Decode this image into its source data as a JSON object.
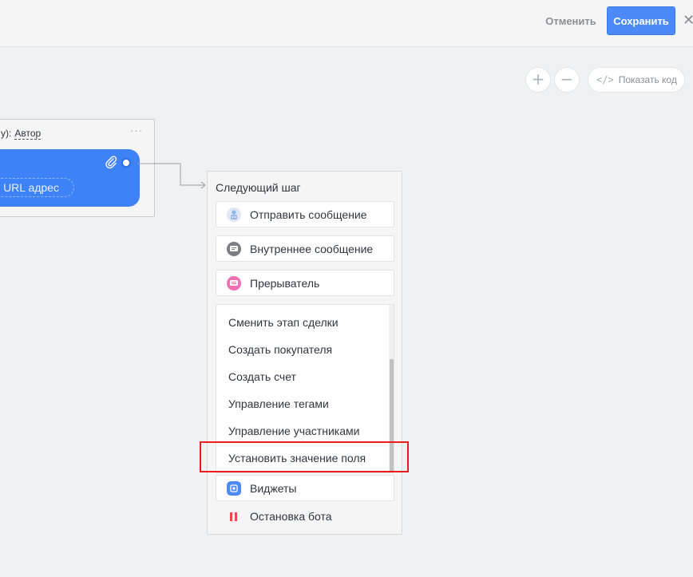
{
  "header": {
    "cancel_label": "Отменить",
    "save_label": "Сохранить",
    "close_icon": "close-icon"
  },
  "toolbar": {
    "zoom_in_icon": "plus",
    "zoom_out_icon": "minus",
    "show_code_label": "Показать код",
    "code_icon_glyph": "</>"
  },
  "node": {
    "header_prefix": "у):",
    "author_label": "Автор",
    "menu_glyph": "···",
    "url_chip_label": "+ URL адрес"
  },
  "next_step": {
    "title": "Следующий шаг",
    "actions": [
      {
        "label": "Отправить сообщение",
        "icon": "bot-icon",
        "color": "#8ab4f8"
      },
      {
        "label": "Внутреннее сообщение",
        "icon": "chat-icon",
        "color": "#7b7f85"
      },
      {
        "label": "Прерыватель",
        "icon": "interrupt-icon",
        "color": "#ee6fb3"
      }
    ],
    "dropdown_items": [
      "Сменить этап сделки",
      "Создать покупателя",
      "Создать счет",
      "Управление тегами",
      "Управление участниками",
      "Установить значение поля"
    ],
    "widgets_label": "Виджеты",
    "widgets_color": "#4c8bf5",
    "stop_label": "Остановка бота",
    "stop_color": "#f0474f"
  },
  "colors": {
    "accent": "#4c8bf5",
    "highlight": "#ea1c1c",
    "card": "#3d82f6"
  }
}
